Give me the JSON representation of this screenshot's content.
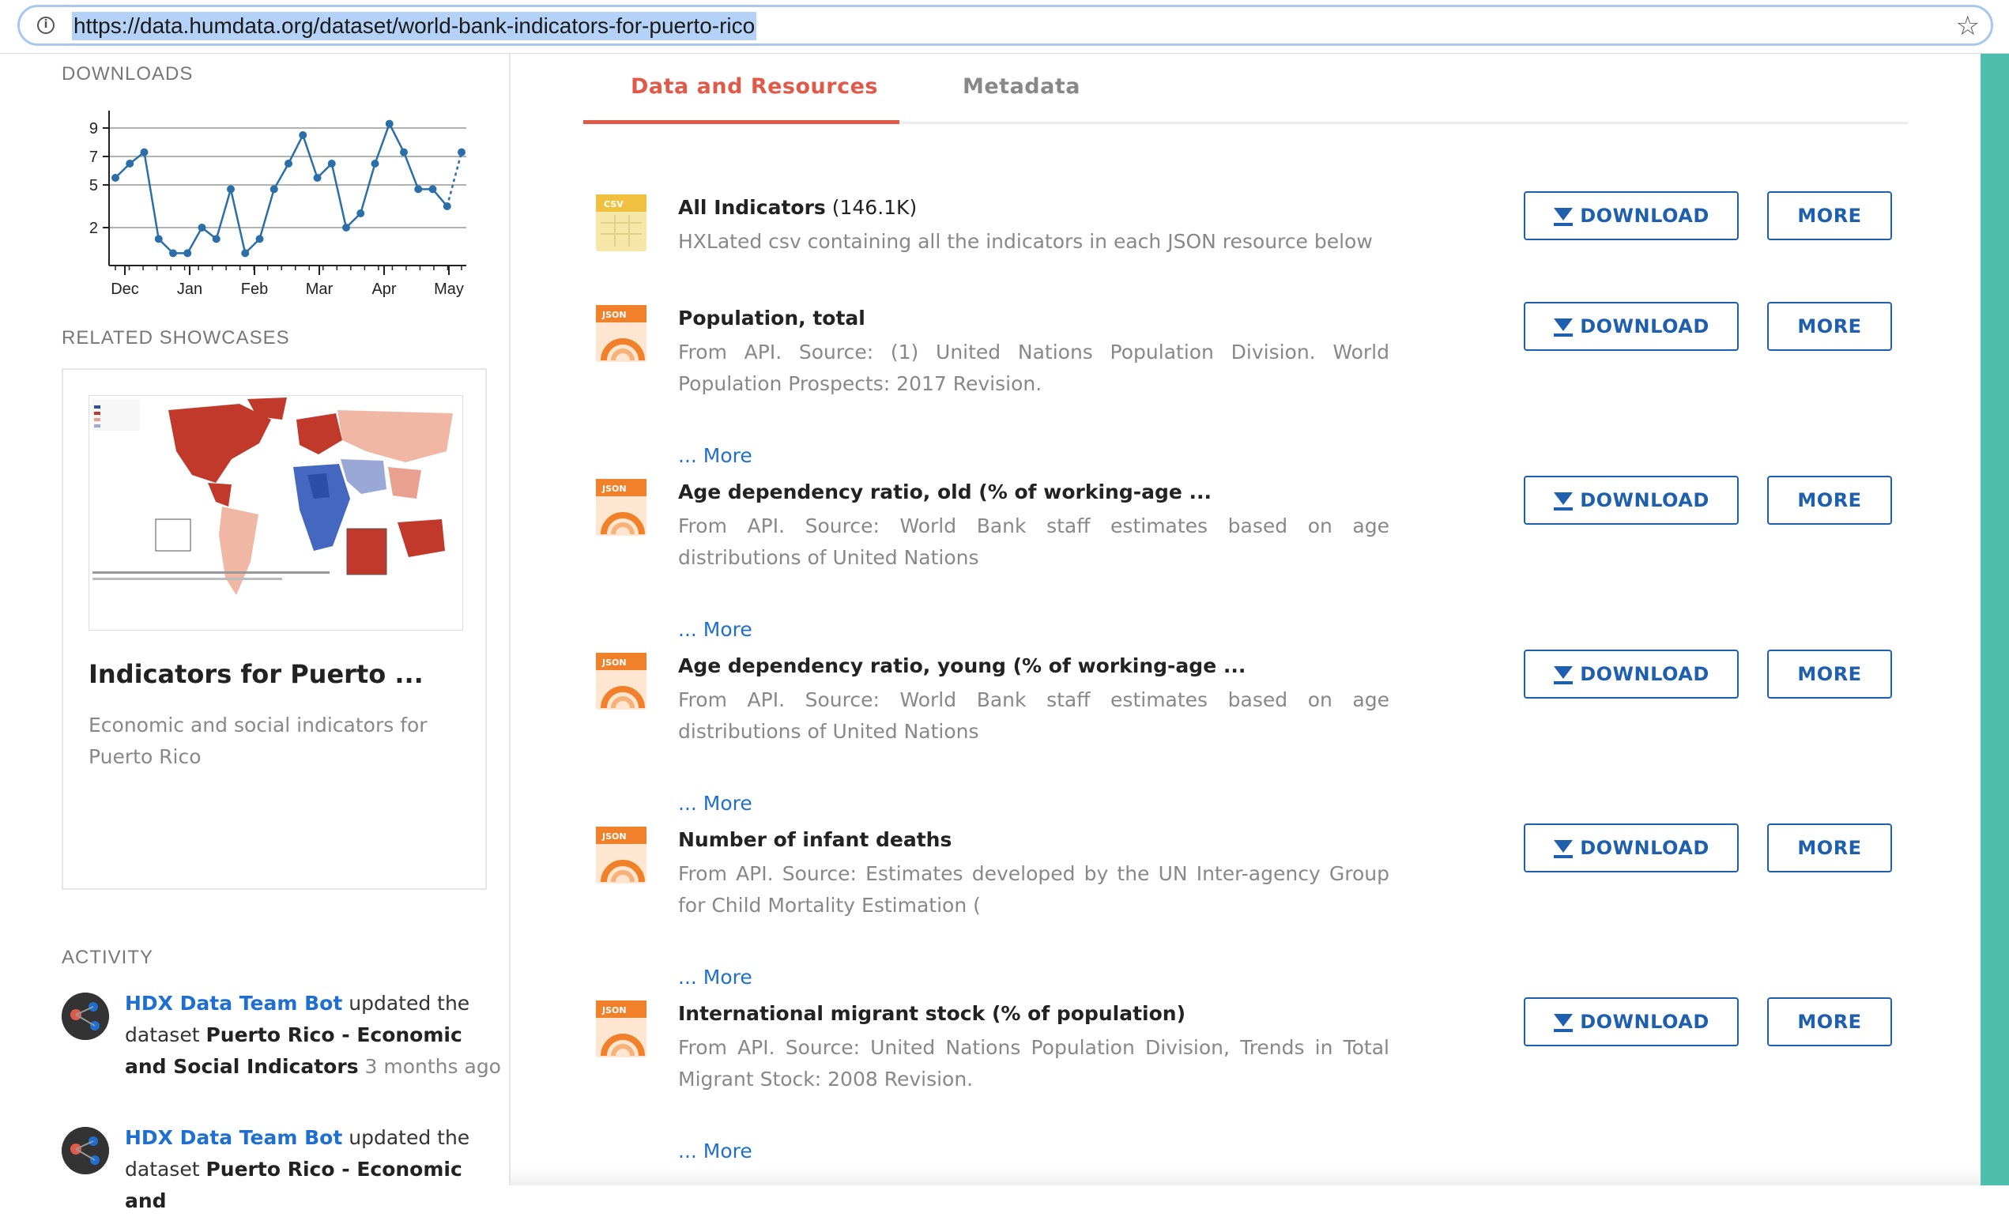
{
  "browser": {
    "url": "https://data.humdata.org/dataset/world-bank-indicators-for-puerto-rico",
    "info_icon": "info-icon",
    "star_icon": "bookmark-star-icon"
  },
  "sidebar": {
    "downloads_label": "DOWNLOADS",
    "related_label": "RELATED SHOWCASES",
    "activity_label": "ACTIVITY",
    "showcase": {
      "title": "Indicators for Puerto ...",
      "description": "Economic and social indicators for Puerto Rico"
    },
    "activity": [
      {
        "actor": "HDX Data Team Bot",
        "verb": "updated the dataset",
        "dataset": "Puerto Rico - Economic and Social Indicators",
        "time": "3 months ago"
      },
      {
        "actor": "HDX Data Team Bot",
        "verb": "updated the dataset",
        "dataset": "Puerto Rico - Economic and"
      }
    ]
  },
  "tabs": [
    {
      "label": "Data and Resources",
      "active": true
    },
    {
      "label": "Metadata",
      "active": false
    }
  ],
  "resources": [
    {
      "title": "All Indicators",
      "size": "(146.1K)",
      "format": "CSV",
      "description": "HXLated csv containing all the indicators in each JSON resource below",
      "more": ""
    },
    {
      "title": "Population, total",
      "size": "",
      "format": "JSON",
      "description": "From API. Source: (1) United Nations Population Division. World Population Prospects: 2017 Revision.",
      "more": "... More"
    },
    {
      "title": "Age dependency ratio, old (% of working-age ...",
      "size": "",
      "format": "JSON",
      "description": "From API. Source: World Bank staff estimates based on age distributions of United Nations",
      "more": "... More"
    },
    {
      "title": "Age dependency ratio, young (% of working-age ...",
      "size": "",
      "format": "JSON",
      "description": "From API. Source: World Bank staff estimates based on age distributions of United Nations",
      "more": "... More"
    },
    {
      "title": "Number of infant deaths",
      "size": "",
      "format": "JSON",
      "description": "From API. Source: Estimates developed by the UN Inter-agency Group for Child Mortality Estimation (",
      "more": "... More"
    },
    {
      "title": "International migrant stock (% of population)",
      "size": "",
      "format": "JSON",
      "description": "From API. Source: United Nations Population Division, Trends in Total Migrant Stock: 2008 Revision.",
      "more": "... More"
    }
  ],
  "buttons": {
    "download": "DOWNLOAD",
    "more": "MORE"
  },
  "colors": {
    "accent": "#e05a4a",
    "link": "#1f6fd1",
    "button": "#1f5fb0",
    "teal_strip": "#4fbfad",
    "chart_line": "#2b6fa8"
  },
  "chart_data": {
    "type": "line",
    "title": "",
    "xlabel": "",
    "ylabel": "",
    "x_ticks": [
      "Dec",
      "Jan",
      "Feb",
      "Mar",
      "Apr",
      "May"
    ],
    "y_ticks": [
      2,
      5,
      7,
      9
    ],
    "ylim": [
      0,
      10
    ],
    "grid": true,
    "series": [
      {
        "values": [
          5.5,
          6.5,
          7.3,
          1.2,
          0.2,
          0.2,
          2,
          1.2,
          4.7,
          0.2,
          1.2,
          4.7,
          6.5,
          8.5,
          5.5,
          6.5,
          2,
          3,
          6.5,
          9.3,
          7.3,
          4.7,
          4.7,
          3.5,
          7.3
        ],
        "last_segment_dashed": true
      }
    ]
  }
}
